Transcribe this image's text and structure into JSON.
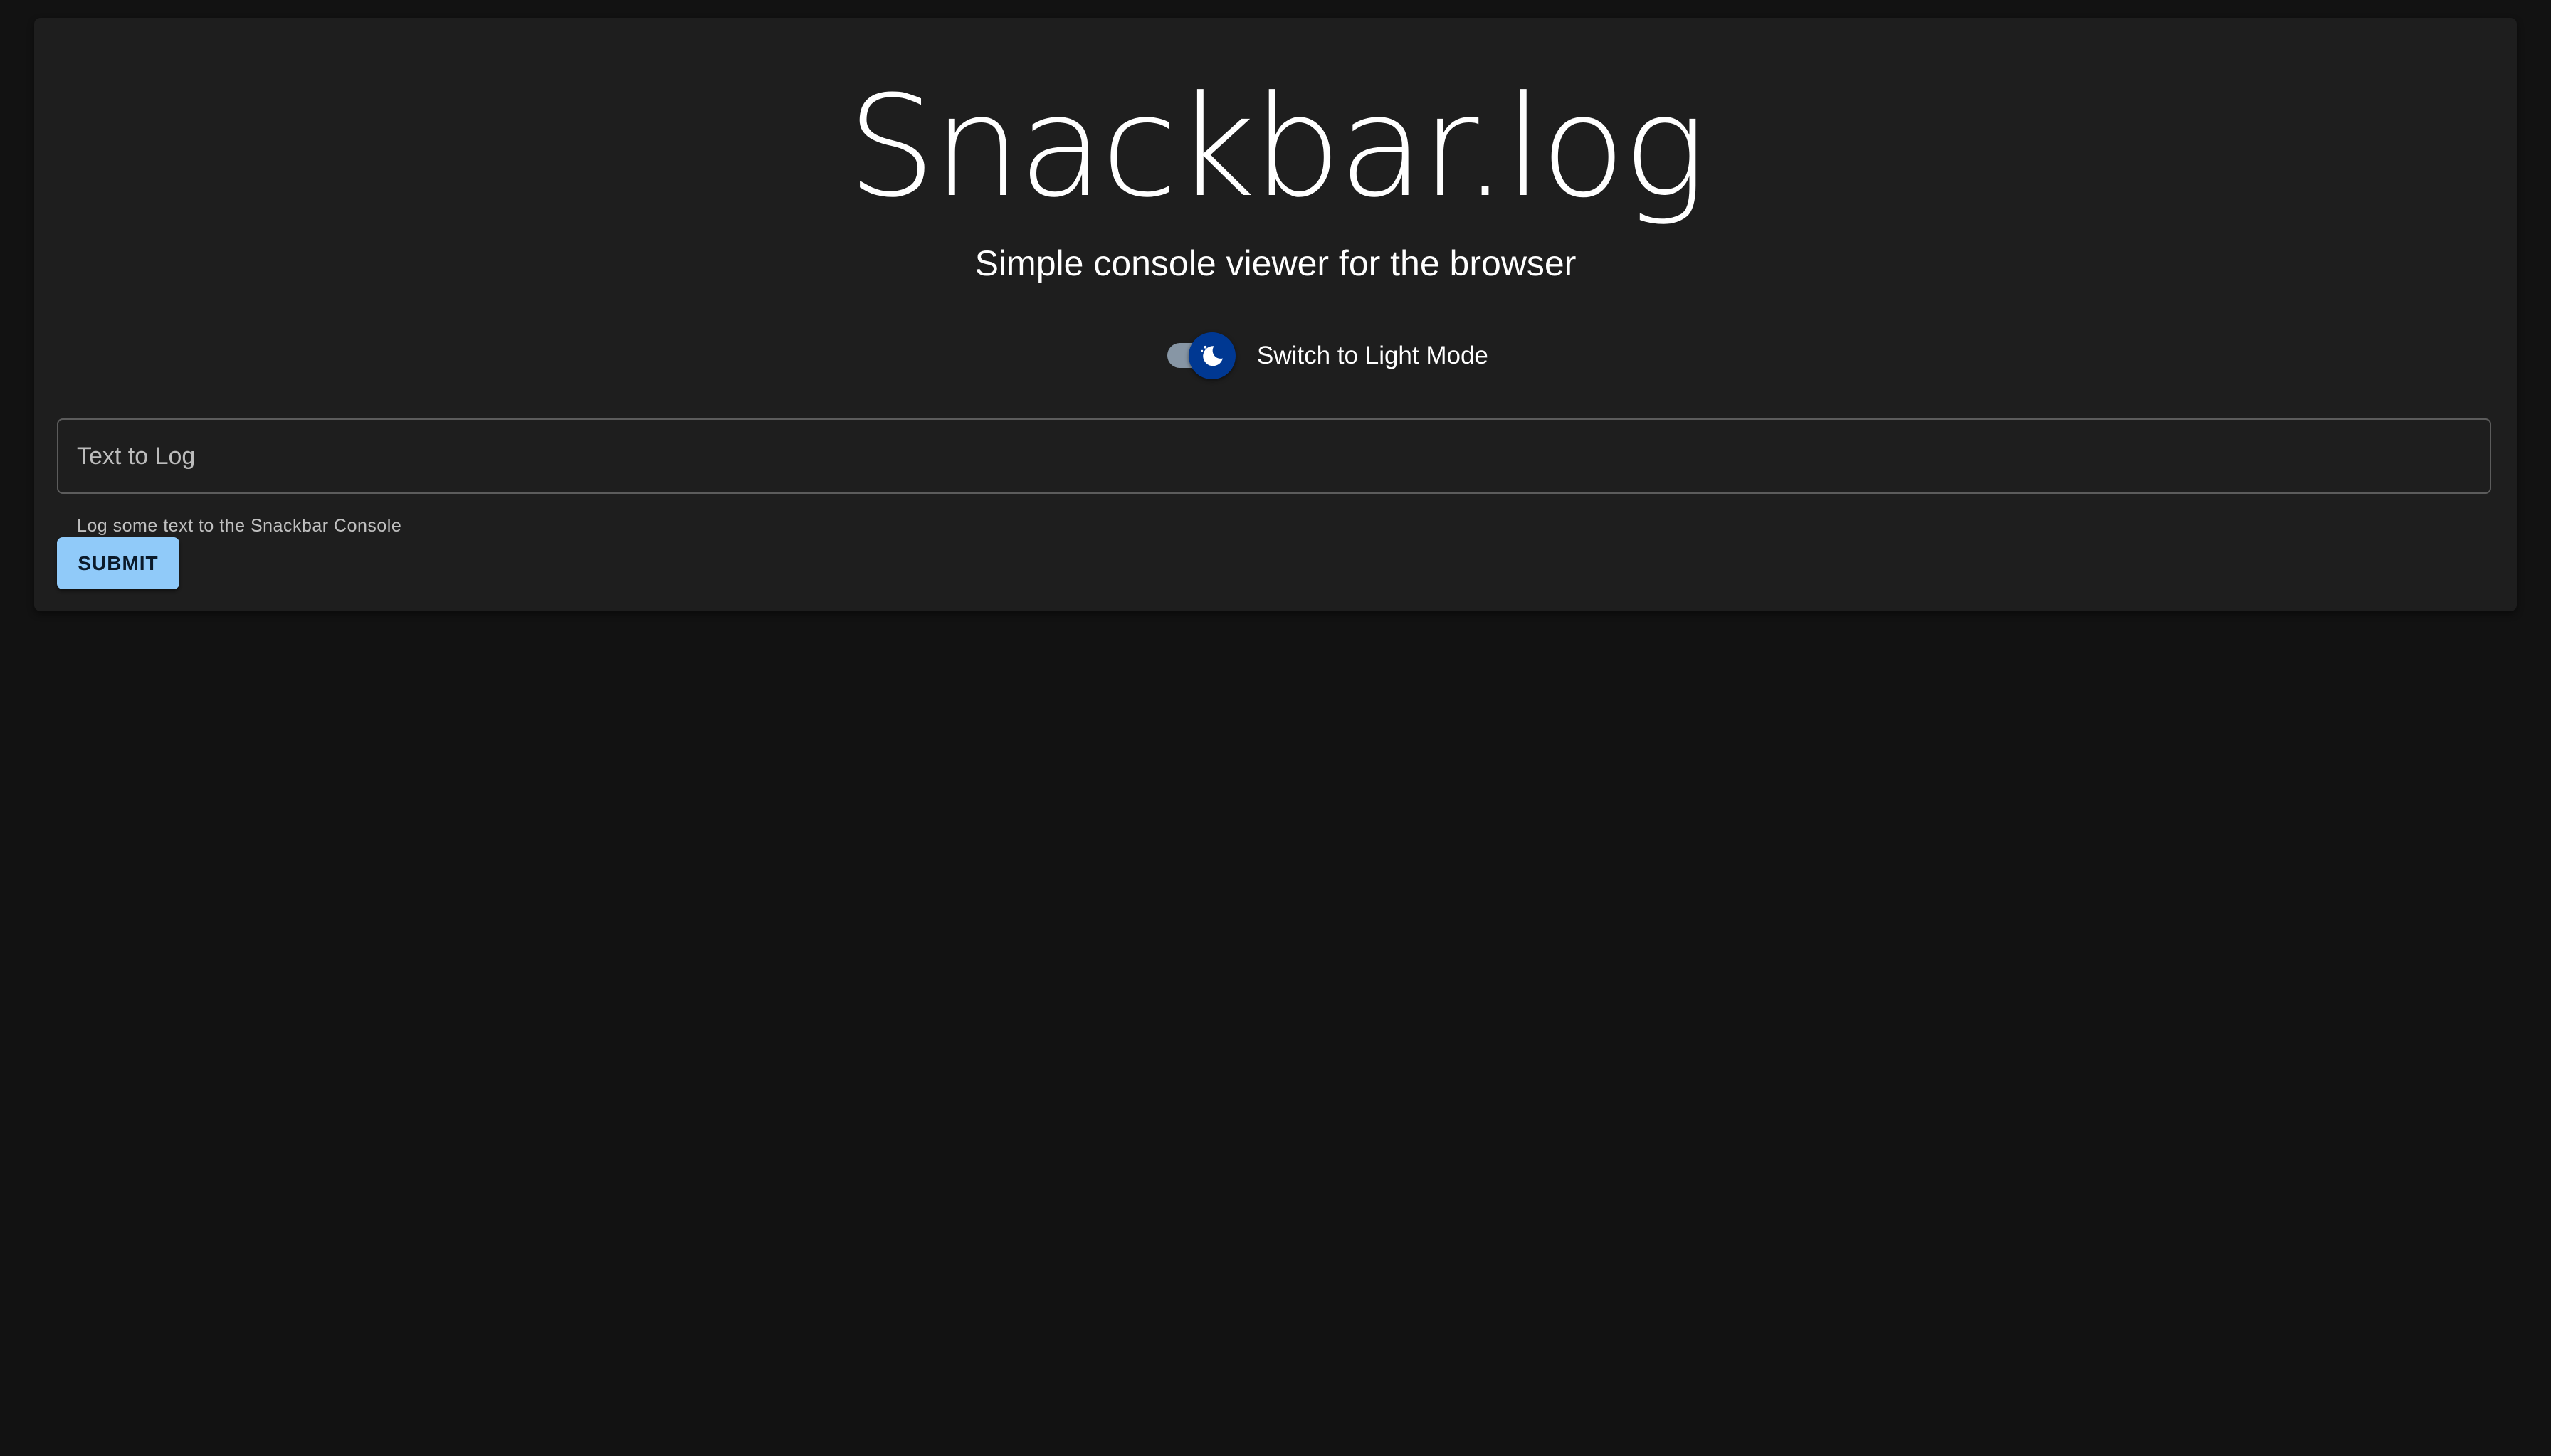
{
  "app": {
    "title": "Snackbar.log",
    "subtitle": "Simple console viewer for the browser"
  },
  "theme_toggle": {
    "label": "Switch to Light Mode",
    "checked": true,
    "icon": "moon-icon",
    "thumb_color": "#003892",
    "track_color": "#8796a5"
  },
  "log_form": {
    "input_placeholder": "Text to Log",
    "input_value": "",
    "helper_text": "Log some text to the Snackbar Console",
    "submit_label": "SUBMIT",
    "submit_color": "#90caf9"
  },
  "colors": {
    "background": "#121212",
    "card": "#1e1e1e",
    "text": "#ffffff"
  }
}
